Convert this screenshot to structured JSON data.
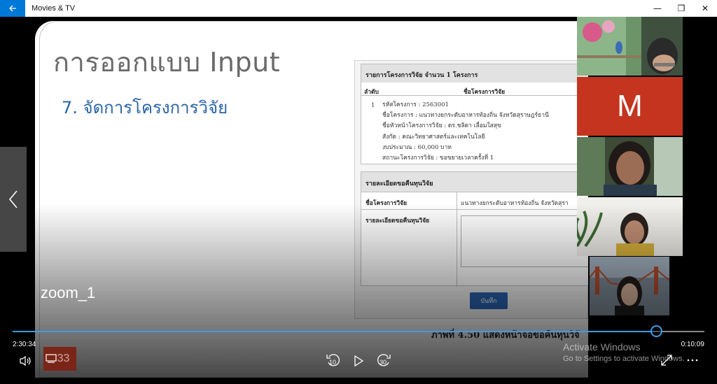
{
  "window": {
    "title": "Movies & TV",
    "minimize_glyph": "—",
    "restore_glyph": "❐",
    "close_glyph": "✕"
  },
  "slide": {
    "title": "การออกแบบ Input",
    "heading": "7. จัดการโครงการวิจัย",
    "screenshot": {
      "list_header": "รายการโครงการวิจัย  จำนวน 1 โครงการ",
      "col_no": "ลำดับ",
      "col_name": "ชื่อโครงการวิจัย",
      "row_no": "1",
      "lines": [
        "รหัสโครงการ : 2563001",
        "ชื่อโครงการ : แนวทางยกระดับอาหารท้องถิ่น จังหวัดสุราษฎร์ธานี",
        "ชื่อหัวหน้าโครงการวิจัย : ดร.ชลิดา เลื่อมใสสุข",
        "สังกัด : คณะวิทยาศาสตร์และเทคโนโลยี",
        "งบประมาณ : 60,000 บาท",
        "สถานะโครงการวิจัย :  ขอขยายเวลาครั้งที่ 1"
      ],
      "form_header": "รายละเอียดขอคืนทุนวิจัย",
      "form_label_name": "ชื่อโครงการวิจัย",
      "form_value_name": "แนวทางยกระดับอาหารท้องถิ่น จังหวัดสุรา",
      "form_label_detail": "รายละเอียดขอคืนทุนวิจัย",
      "save_label": "บันทึก"
    },
    "caption": "ภาพที่ 4.50 แสดงหน้าจอขอคืนทุนวิจั"
  },
  "overlay": {
    "zoom_label": "zoom_1",
    "participant_initial": "M"
  },
  "player": {
    "elapsed": "2:30:34",
    "remaining": "0:10:09",
    "progress_fraction": 0.93,
    "skip_back_label": "10",
    "skip_forward_label": "30",
    "subtitle_badge": "33",
    "accent_color": "#3e9be5"
  },
  "watermark": {
    "line1": "Activate Windows",
    "line2": "Go to Settings to activate Windows."
  }
}
